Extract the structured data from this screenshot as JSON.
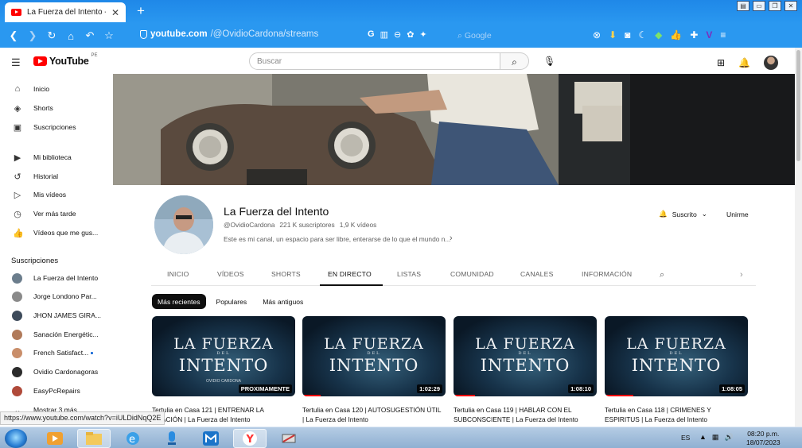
{
  "browser": {
    "tab_title": "La Fuerza del Intento - Y",
    "new_tab": "+",
    "url_host": "youtube.com",
    "url_path": "/@OvidioCardona/streams",
    "search_placeholder": "Google"
  },
  "youtube": {
    "logo_text": "YouTube",
    "region": "PE",
    "search_placeholder": "Buscar"
  },
  "sidebar": {
    "primary": [
      {
        "label": "Inicio",
        "icon": "home-icon"
      },
      {
        "label": "Shorts",
        "icon": "shorts-icon"
      },
      {
        "label": "Suscripciones",
        "icon": "subscriptions-icon"
      }
    ],
    "library": [
      {
        "label": "Mi biblioteca",
        "icon": "library-icon"
      },
      {
        "label": "Historial",
        "icon": "history-icon"
      },
      {
        "label": "Mis vídeos",
        "icon": "my-videos-icon"
      },
      {
        "label": "Ver más tarde",
        "icon": "watch-later-icon"
      },
      {
        "label": "Vídeos que me gus...",
        "icon": "liked-icon"
      }
    ],
    "subscriptions_heading": "Suscripciones",
    "subscriptions": [
      {
        "label": "La Fuerza del Intento",
        "color": "#6b7d8c"
      },
      {
        "label": "Jorge Londono Par...",
        "color": "#8a8a8a"
      },
      {
        "label": "JHON JAMES GIRA...",
        "color": "#3d4a5a"
      },
      {
        "label": "Sanación Energétic...",
        "color": "#b07a5a"
      },
      {
        "label": "French Satisfact...",
        "color": "#c98e6a",
        "new": true
      },
      {
        "label": "Ovidio Cardonagoras",
        "color": "#2b2b2b"
      },
      {
        "label": "EasyPcRepairs",
        "color": "#b04a3a"
      },
      {
        "label": "Mostrar 3 más",
        "color": "#ffffff"
      }
    ]
  },
  "channel": {
    "name": "La Fuerza del Intento",
    "handle": "@OvidioCardona",
    "subscribers": "221 K suscriptores",
    "videos_count": "1,9 K vídeos",
    "description": "Este es mi canal, un espacio para ser libre, enterarse de lo que el mundo n...",
    "subscribed_label": "Suscrito",
    "join_label": "Unirme"
  },
  "tabs": [
    "INICIO",
    "VÍDEOS",
    "SHORTS",
    "EN DIRECTO",
    "LISTAS",
    "COMUNIDAD",
    "CANALES",
    "INFORMACIÓN"
  ],
  "active_tab": "EN DIRECTO",
  "chips": [
    "Más recientes",
    "Populares",
    "Más antiguos"
  ],
  "thumbnail_text": {
    "line1": "LA FUERZA",
    "line2": "DEL",
    "line3": "INTENTO",
    "line4": "OVIDIO CARDONA"
  },
  "videos": [
    {
      "title": "Tertulia en Casa 121 | ENTRENAR LA ...ZACIÓN | La Fuerza del Intento",
      "duration": "PROXIMAMENTE",
      "progress": 0
    },
    {
      "title": "Tertulia en Casa 120 | AUTOSUGESTIÓN ÚTIL | La Fuerza del Intento",
      "duration": "1:02:29",
      "progress": 0.13
    },
    {
      "title": "Tertulia en Casa 119 | HABLAR CON EL SUBCONSCIENTE | La Fuerza del Intento",
      "duration": "1:08:10",
      "progress": 0.15
    },
    {
      "title": "Tertulia en Casa 118 | CRIMENES Y ESPIRITUS | La Fuerza del Intento",
      "duration": "1:08:05",
      "progress": 0.2
    }
  ],
  "status_url": "https://www.youtube.com/watch?v=iULDidNqQ2E",
  "taskbar": {
    "language": "ES",
    "time": "08:20 p.m.",
    "date": "18/07/2023"
  }
}
